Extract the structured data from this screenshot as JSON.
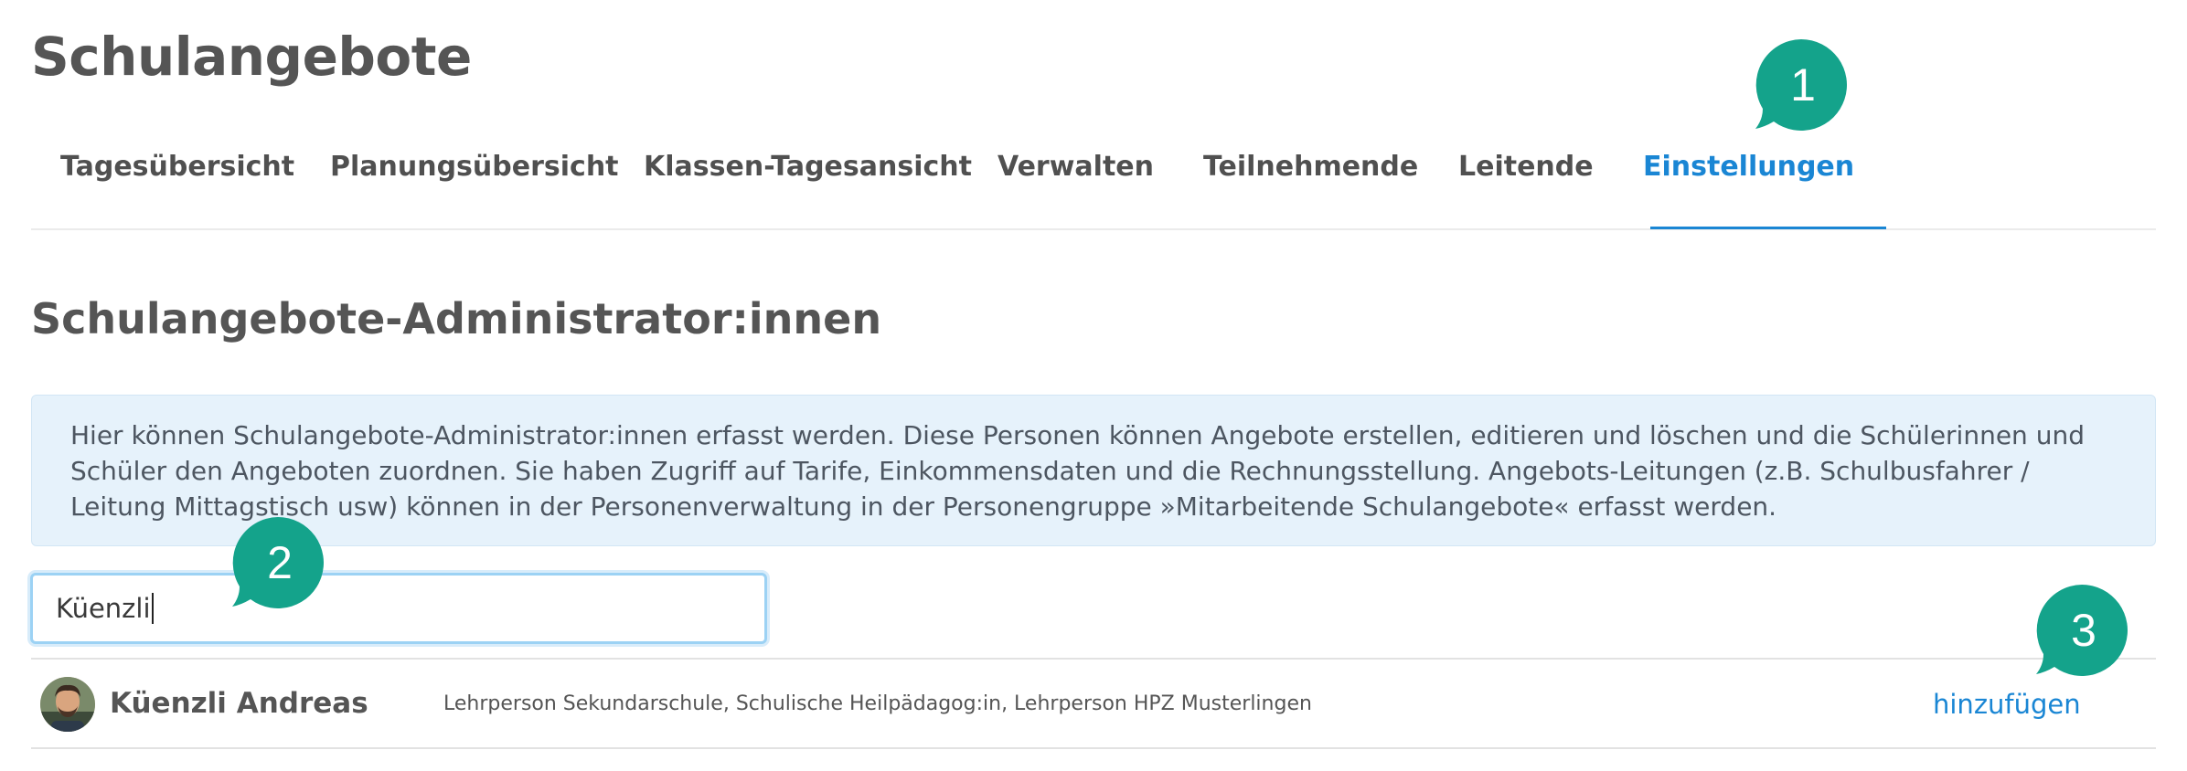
{
  "page": {
    "title": "Schulangebote"
  },
  "tabs": [
    {
      "label": "Tagesübersicht",
      "active": false
    },
    {
      "label": "Planungsübersicht",
      "active": false
    },
    {
      "label": "Klassen-Tagesansicht",
      "active": false
    },
    {
      "label": "Verwalten",
      "active": false
    },
    {
      "label": "Teilnehmende",
      "active": false
    },
    {
      "label": "Leitende",
      "active": false
    },
    {
      "label": "Einstellungen",
      "active": true
    }
  ],
  "section": {
    "title": "Schulangebote-Administrator:innen",
    "info": "Hier können Schulangebote-Administrator:innen erfasst werden. Diese Personen können Angebote erstellen, editieren und löschen und die Schülerinnen und Schüler den Angeboten zuordnen. Sie haben Zugriff auf Tarife, Einkommensdaten und die Rechnungsstellung. Angebots-Leitungen (z.B. Schulbusfahrer / Leitung Mittagstisch usw) können in der Personenverwaltung in der Personengruppe »Mitarbeitende Schulangebote« erfasst werden."
  },
  "search": {
    "value": "Küenzli"
  },
  "results": [
    {
      "name": "Küenzli Andreas",
      "roles": "Lehrperson Sekundarschule, Schulische Heilpädagog:in, Lehrperson HPZ Musterlingen",
      "action": "hinzufügen"
    }
  ],
  "badges": [
    "1",
    "2",
    "3"
  ],
  "colors": {
    "accent": "#1a86d4",
    "badge": "#14a38b",
    "info_bg": "#e6f2fb"
  }
}
